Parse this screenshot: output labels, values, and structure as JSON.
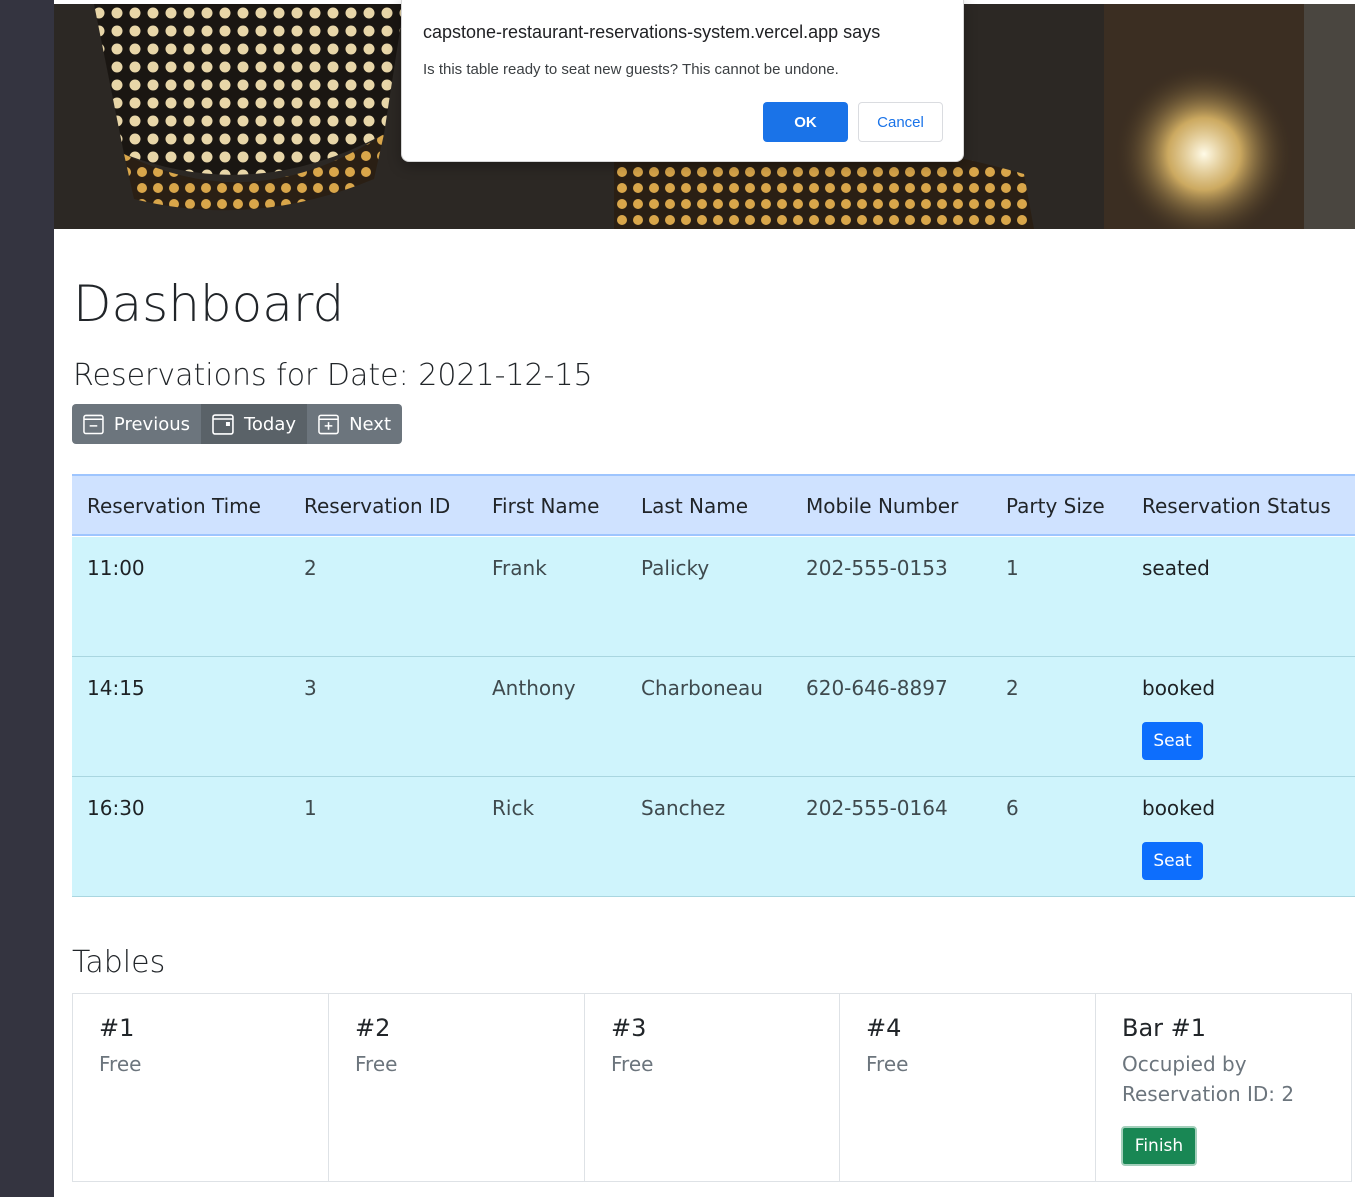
{
  "dialog": {
    "title": "capstone-restaurant-reservations-system.vercel.app says",
    "message": "Is this table ready to seat new guests? This cannot be undone.",
    "ok_label": "OK",
    "cancel_label": "Cancel"
  },
  "page": {
    "title": "Dashboard",
    "subtitle": "Reservations for Date: 2021-12-15"
  },
  "date_nav": {
    "previous_label": "Previous",
    "today_label": "Today",
    "next_label": "Next"
  },
  "reservations": {
    "headers": [
      "Reservation Time",
      "Reservation ID",
      "First Name",
      "Last Name",
      "Mobile Number",
      "Party Size",
      "Reservation Status"
    ],
    "rows": [
      {
        "time": "11:00",
        "id": "2",
        "first": "Frank",
        "last": "Palicky",
        "mobile": "202-555-0153",
        "party": "1",
        "status": "seated",
        "seat_label": ""
      },
      {
        "time": "14:15",
        "id": "3",
        "first": "Anthony",
        "last": "Charboneau",
        "mobile": "620-646-8897",
        "party": "2",
        "status": "booked",
        "seat_label": "Seat"
      },
      {
        "time": "16:30",
        "id": "1",
        "first": "Rick",
        "last": "Sanchez",
        "mobile": "202-555-0164",
        "party": "6",
        "status": "booked",
        "seat_label": "Seat"
      }
    ]
  },
  "tables": {
    "heading": "Tables",
    "items": [
      {
        "name": "#1",
        "status": "Free"
      },
      {
        "name": "#2",
        "status": "Free"
      },
      {
        "name": "#3",
        "status": "Free"
      },
      {
        "name": "#4",
        "status": "Free"
      },
      {
        "name": "Bar #1",
        "status": "Occupied by Reservation ID: 2",
        "finish_label": "Finish"
      }
    ]
  },
  "colors": {
    "primary": "#0d6efd",
    "success": "#198754",
    "secondary": "#6c757d",
    "dialog_ok": "#1a73e8",
    "table_header": "#cfe2ff",
    "table_row": "#cff4fc",
    "sidebar": "#343440"
  }
}
